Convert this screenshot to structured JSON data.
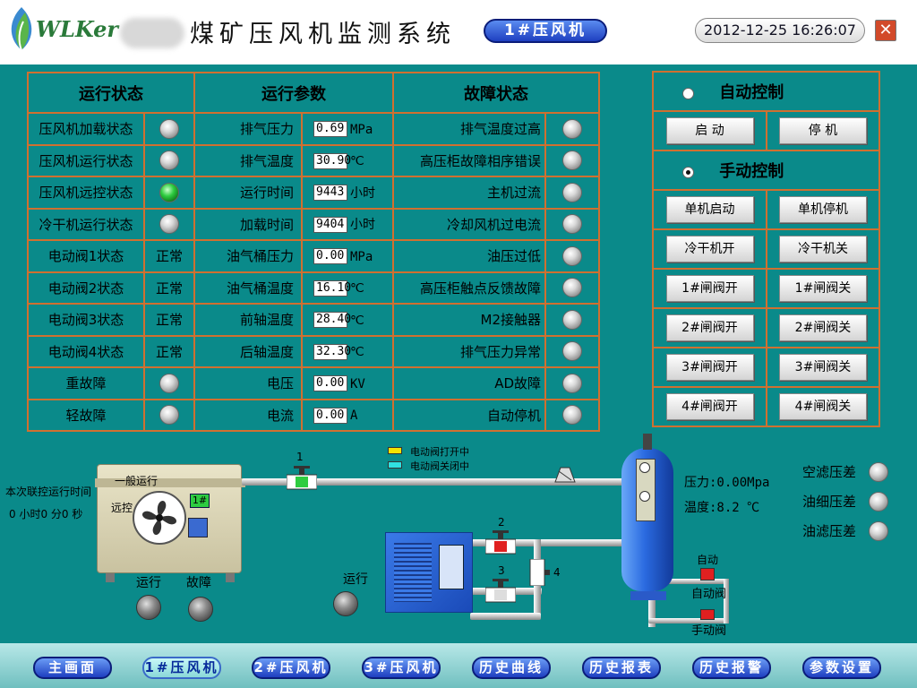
{
  "header": {
    "logo_text": "WLKer",
    "title": "煤矿压风机监测系统",
    "badge": "1#压风机",
    "datetime": "2012-12-25 16:26:07",
    "close_icon": "close-icon"
  },
  "table": {
    "headers": {
      "status": "运行状态",
      "params": "运行参数",
      "faults": "故障状态"
    },
    "status_rows": [
      {
        "label": "压风机加载状态",
        "text": "",
        "led": "off"
      },
      {
        "label": "压风机运行状态",
        "text": "",
        "led": "off"
      },
      {
        "label": "压风机远控状态",
        "text": "",
        "led": "on"
      },
      {
        "label": "冷干机运行状态",
        "text": "",
        "led": "off"
      },
      {
        "label": "电动阀1状态",
        "text": "正常",
        "led": "none"
      },
      {
        "label": "电动阀2状态",
        "text": "正常",
        "led": "none"
      },
      {
        "label": "电动阀3状态",
        "text": "正常",
        "led": "none"
      },
      {
        "label": "电动阀4状态",
        "text": "正常",
        "led": "none"
      },
      {
        "label": "重故障",
        "text": "",
        "led": "off"
      },
      {
        "label": "轻故障",
        "text": "",
        "led": "off"
      }
    ],
    "param_rows": [
      {
        "label": "排气压力",
        "value": "0.69",
        "unit": "MPa"
      },
      {
        "label": "排气温度",
        "value": "30.90",
        "unit": "℃"
      },
      {
        "label": "运行时间",
        "value": "9443",
        "unit": "小时"
      },
      {
        "label": "加载时间",
        "value": "9404",
        "unit": "小时"
      },
      {
        "label": "油气桶压力",
        "value": "0.00",
        "unit": "MPa"
      },
      {
        "label": "油气桶温度",
        "value": "16.10",
        "unit": "℃"
      },
      {
        "label": "前轴温度",
        "value": "28.40",
        "unit": "℃"
      },
      {
        "label": "后轴温度",
        "value": "32.30",
        "unit": "℃"
      },
      {
        "label": "电压",
        "value": "0.00",
        "unit": "KV"
      },
      {
        "label": "电流",
        "value": "0.00",
        "unit": "A"
      }
    ],
    "fault_rows": [
      "排气温度过高",
      "高压柜故障相序错误",
      "主机过流",
      "冷却风机过电流",
      "油压过低",
      "高压柜触点反馈故障",
      "M2接触器",
      "排气压力异常",
      "AD故障",
      "自动停机"
    ]
  },
  "control": {
    "auto_label": "自动控制",
    "auto_selected": false,
    "start": "启 动",
    "stop": "停 机",
    "manual_label": "手动控制",
    "manual_selected": true,
    "buttons": [
      [
        "单机启动",
        "单机停机"
      ],
      [
        "冷干机开",
        "冷干机关"
      ],
      [
        "1#闸阀开",
        "1#闸阀关"
      ],
      [
        "2#闸阀开",
        "2#闸阀关"
      ],
      [
        "3#闸阀开",
        "3#闸阀关"
      ],
      [
        "4#闸阀开",
        "4#闸阀关"
      ]
    ]
  },
  "diagram": {
    "linkage_label": "本次联控运行时间",
    "linkage_time": "0 小时0 分0 秒",
    "general_run": "一般运行",
    "remote": "远控",
    "unit_no": "1#",
    "run": "运行",
    "fault": "故障",
    "dryer_run": "运行",
    "legend_open": "电动阀打开中",
    "legend_close": "电动阀关闭中",
    "legend_open_color": "#f5e200",
    "legend_close_color": "#30e0e0",
    "valve_nums": [
      "1",
      "2",
      "3",
      "4"
    ],
    "pressure": "压力:0.00Mpa",
    "temperature": "温度:8.2 ℃",
    "auto_text": "自动",
    "auto_valve": "自动阀",
    "manual_valve": "手动阀",
    "filters": [
      "空滤压差",
      "油细压差",
      "油滤压差"
    ]
  },
  "nav": [
    "主画面",
    "1#压风机",
    "2#压风机",
    "3#压风机",
    "历史曲线",
    "历史报表",
    "历史报警",
    "参数设置"
  ],
  "nav_active": 1
}
